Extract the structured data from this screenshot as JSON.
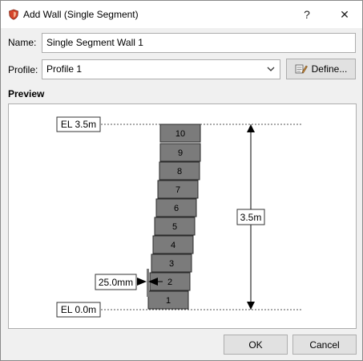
{
  "window": {
    "title": "Add Wall (Single Segment)",
    "help_glyph": "?",
    "close_glyph": "✕"
  },
  "form": {
    "name_label": "Name:",
    "name_value": "Single Segment Wall 1",
    "profile_label": "Profile:",
    "profile_value": "Profile 1",
    "define_button": "Define..."
  },
  "preview": {
    "title": "Preview",
    "el_top": "EL 3.5m",
    "el_bottom": "EL 0.0m",
    "height_label": "3.5m",
    "offset_label": "25.0mm",
    "blocks": [
      "1",
      "2",
      "3",
      "4",
      "5",
      "6",
      "7",
      "8",
      "9",
      "10"
    ]
  },
  "footer": {
    "ok_label": "OK",
    "cancel_label": "Cancel"
  },
  "colors": {
    "block_fill": "#7b7b7b",
    "block_stroke": "#2a2a2a",
    "icon_accent": "#d6452a"
  }
}
